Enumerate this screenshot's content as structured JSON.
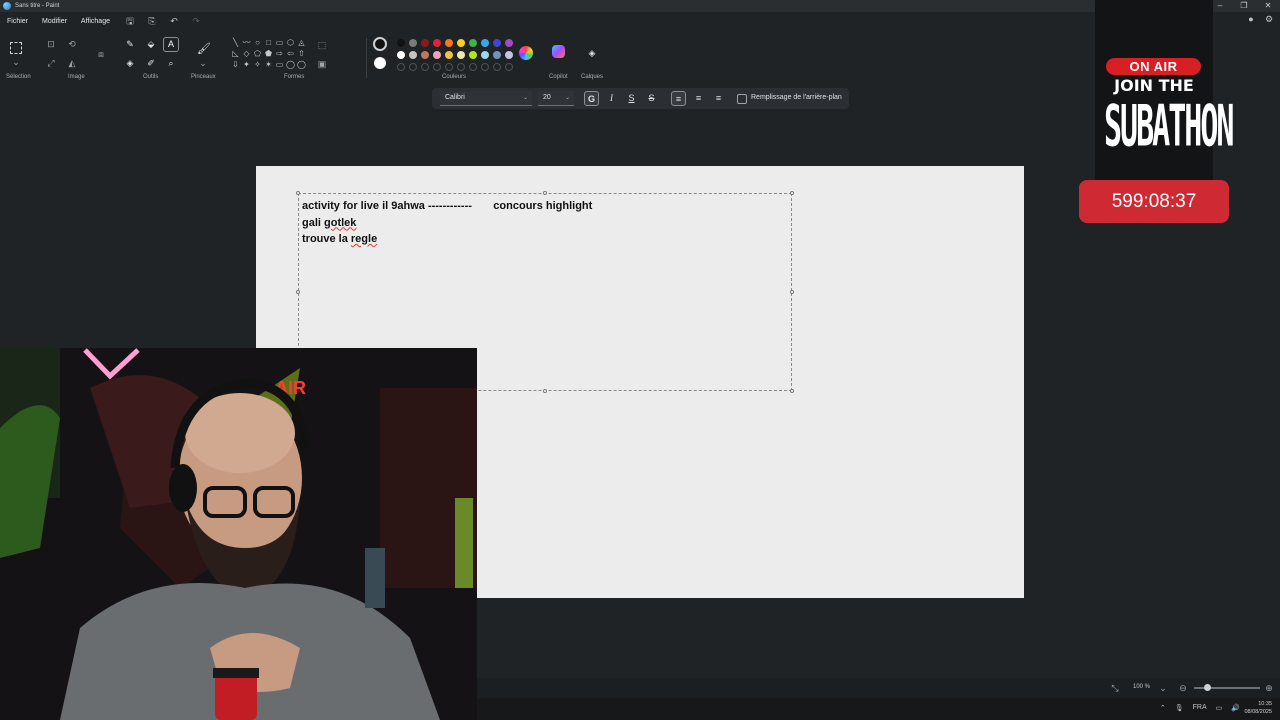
{
  "window": {
    "title": "Sans titre - Paint"
  },
  "menu": [
    "Fichier",
    "Modifier",
    "Affichage"
  ],
  "ribbon": {
    "groups": {
      "selection": "Sélection",
      "image": "Image",
      "outils": "Outils",
      "pinceaux": "Pinceaux",
      "formes": "Formes",
      "couleurs": "Couleurs",
      "copilot": "Copilot",
      "calques": "Calques"
    },
    "active_tool_glyph": "A",
    "shape_glyphs": [
      "╲",
      "〰",
      "○",
      "□",
      "▭",
      "⬡",
      "◬",
      "◺",
      "◇",
      "⬠",
      "⬟",
      "⇨",
      "⇦",
      "⇧",
      "⇩",
      "✦",
      "✧",
      "✶",
      "▭",
      "◯",
      "◯"
    ],
    "colors": {
      "primary": "#111111",
      "secondary": "#ffffff",
      "palette_row1": [
        "#111111",
        "#7a7a7a",
        "#8a1a1a",
        "#e0242e",
        "#f27a22",
        "#f7d21f",
        "#3fb24a",
        "#35a9e8",
        "#3f48cc",
        "#a24bc0"
      ],
      "palette_row2": [
        "#ffffff",
        "#c3c3c3",
        "#b97a57",
        "#f4a0b7",
        "#f4c041",
        "#efe4b0",
        "#b5e61d",
        "#99d9ea",
        "#7092be",
        "#c8bfe7"
      ]
    }
  },
  "text_toolbar": {
    "font": "Calibri",
    "size": "20",
    "bold_glyph": "G",
    "italic_glyph": "I",
    "underline_glyph": "S",
    "strike_glyph": "S",
    "background_fill_label": "Remplissage de l'arrière-plan"
  },
  "canvas_text": {
    "line1_a": "activity for live il 9ahwa ------------       ",
    "line1_b": "concours highlight",
    "line2_a": "gali ",
    "line2_b": "gotlek",
    "line3_a": "trouve la ",
    "line3_b": "regle"
  },
  "overlay": {
    "on_air": "ON AIR",
    "join": "JOIN THE",
    "subathon": "SUBATHON",
    "timer": "599:08:37"
  },
  "status": {
    "zoom": "100 %"
  },
  "taskbar": {
    "lang": "FRA",
    "time": "10:35",
    "date": "08/08/2025"
  }
}
